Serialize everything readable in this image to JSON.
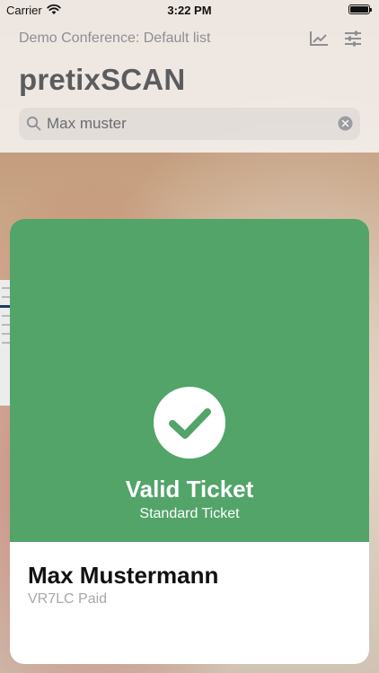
{
  "status_bar": {
    "carrier": "Carrier",
    "time": "3:22 PM"
  },
  "navigation": {
    "list_title": "Demo Conference: Default list",
    "app_title": "pretixSCAN",
    "icons": [
      "chart-icon",
      "filter-settings-icon"
    ]
  },
  "search": {
    "value": "Max muster"
  },
  "result": {
    "status": "Valid Ticket",
    "ticket_type": "Standard Ticket",
    "attendee_name": "Max Mustermann",
    "order_info": "VR7LC Paid",
    "status_color": "#52a469"
  }
}
